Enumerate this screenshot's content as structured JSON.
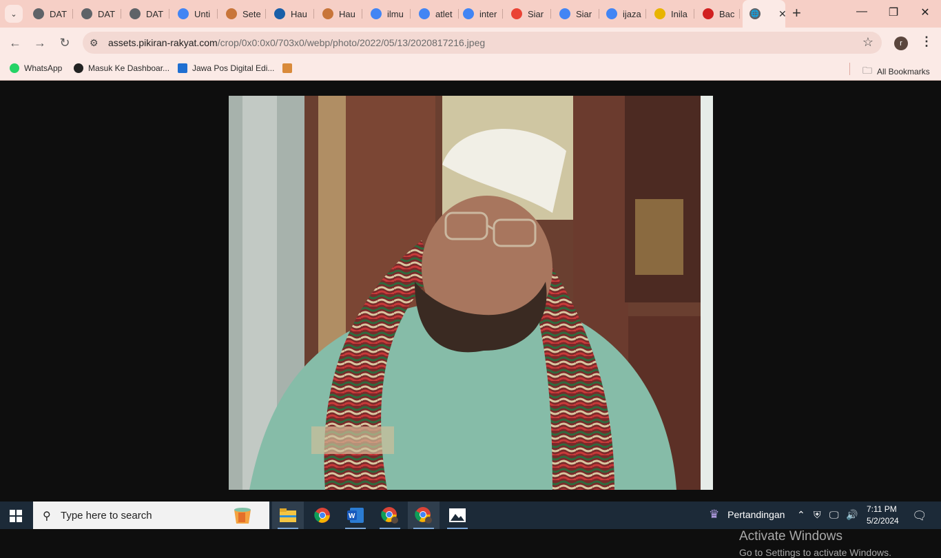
{
  "tabs": [
    {
      "label": "DAT",
      "icon": "globe-icon",
      "color": "#5f6368"
    },
    {
      "label": "DAT",
      "icon": "globe-icon",
      "color": "#5f6368"
    },
    {
      "label": "DAT",
      "icon": "globe-icon",
      "color": "#5f6368"
    },
    {
      "label": "Unti",
      "icon": "docs-icon",
      "color": "#4285f4"
    },
    {
      "label": "Sete",
      "icon": "site-icon",
      "color": "#c8753a"
    },
    {
      "label": "Hau",
      "icon": "site-icon",
      "color": "#1a5fa8"
    },
    {
      "label": "Hau",
      "icon": "site-icon",
      "color": "#c8753a"
    },
    {
      "label": "ilmu",
      "icon": "google-icon",
      "color": "#4285f4"
    },
    {
      "label": "atlet",
      "icon": "google-icon",
      "color": "#4285f4"
    },
    {
      "label": "inter",
      "icon": "google-icon",
      "color": "#4285f4"
    },
    {
      "label": "Siar",
      "icon": "gmail-icon",
      "color": "#ea4335"
    },
    {
      "label": "Siar",
      "icon": "docs-icon",
      "color": "#4285f4"
    },
    {
      "label": "ijaza",
      "icon": "google-icon",
      "color": "#4285f4"
    },
    {
      "label": "Inila",
      "icon": "site-icon",
      "color": "#e8b400"
    },
    {
      "label": "Bac",
      "icon": "site-icon",
      "color": "#d12020"
    }
  ],
  "active_tab": {
    "icon": "globe-icon"
  },
  "address": {
    "host": "assets.pikiran-rakyat.com",
    "path": "/crop/0x0:0x0/703x0/webp/photo/2022/05/13/2020817216.jpeg"
  },
  "profile_initial": "r",
  "bookmarks": {
    "items": [
      {
        "label": "WhatsApp",
        "icon": "whatsapp-icon",
        "color": "#25d366"
      },
      {
        "label": "Masuk Ke Dashboar...",
        "icon": "dashboard-icon",
        "color": "#222222"
      },
      {
        "label": "Jawa Pos Digital Edi...",
        "icon": "jawapos-icon",
        "color": "#1f6fd1"
      },
      {
        "label": "",
        "icon": "jp-icon",
        "color": "#d98a3a"
      }
    ],
    "all_label": "All Bookmarks"
  },
  "watermark": {
    "line1": "Activate Windows",
    "line2": "Go to Settings to activate Windows."
  },
  "taskbar": {
    "search_placeholder": "Type here to search",
    "weather_label": "Pertandingan",
    "time": "7:11 PM",
    "date": "5/2/2024"
  }
}
